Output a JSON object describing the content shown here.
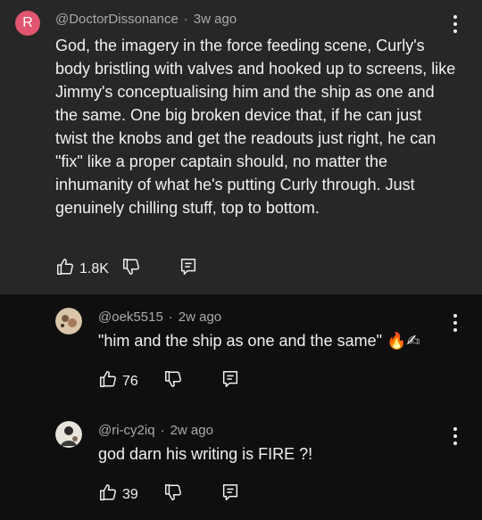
{
  "main_comment": {
    "avatar_letter": "R",
    "avatar_color": "#e0556f",
    "author": "@DoctorDissonance",
    "time": "3w ago",
    "text": "God, the imagery in the force feeding scene, Curly's body bristling with valves and hooked up to screens, like Jimmy's conceptualising him and the ship as one and the same. One big broken device that, if he can just twist the knobs and get the readouts just right, he can \"fix\" like a proper captain should, no matter the inhumanity of what he's putting Curly through. Just genuinely chilling stuff, top to bottom.",
    "likes": "1.8K"
  },
  "replies": [
    {
      "author": "@oek5515",
      "time": "2w ago",
      "text": "\"him and the ship as one and the same\" 🔥✍",
      "likes": "76"
    },
    {
      "author": "@ri-cy2iq",
      "time": "2w ago",
      "text": "god darn his writing is FIRE ?!",
      "likes": "39"
    }
  ],
  "separator": "·",
  "icons": [
    "thumbs-up-icon",
    "thumbs-down-icon",
    "reply-icon",
    "more-vert-icon"
  ]
}
